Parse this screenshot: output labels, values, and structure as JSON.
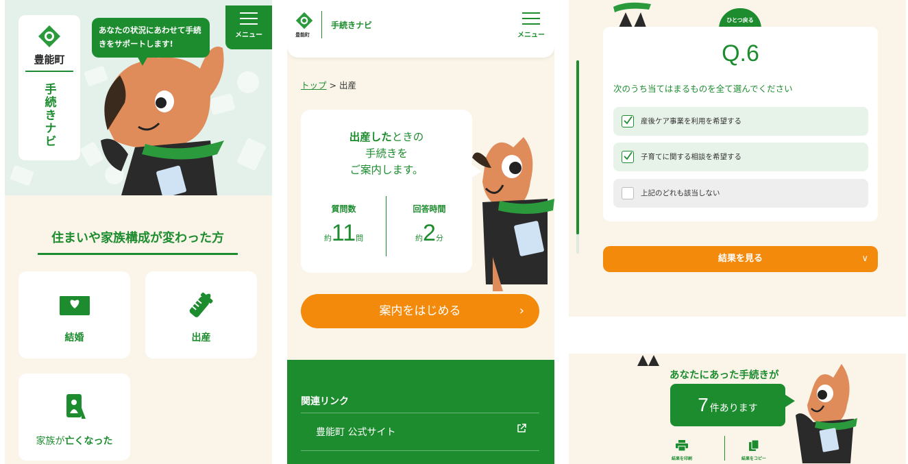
{
  "colors": {
    "green": "#1d8c2f",
    "orange": "#f48a0b",
    "cream": "#faf5e8",
    "mint": "#e4f0ea"
  },
  "panel1": {
    "logo": {
      "town": "豊能町",
      "app": "手続きナビ"
    },
    "speech": "あなたの状況にあわせて手続きをサポートします!",
    "menu_label": "メニュー",
    "section_title": "住まいや家族構成が変わった方",
    "categories": [
      {
        "icon": "letter-heart-icon",
        "label": "結婚"
      },
      {
        "icon": "baby-bottle-icon",
        "label": "出産"
      },
      {
        "icon": "portrait-frame-icon",
        "label_prefix": "家族が",
        "label_bold": "亡くなった"
      }
    ]
  },
  "panel2": {
    "header": {
      "town": "豊能町",
      "title": "手続きナビ",
      "menu_label": "メニュー"
    },
    "breadcrumb": {
      "top": "トップ",
      "sep": ">",
      "current": "出産"
    },
    "intro": {
      "bold": "出産した",
      "rest1": "ときの",
      "line2": "手続きを",
      "line3": "ご案内します。"
    },
    "stats": [
      {
        "label": "質問数",
        "prefix": "約",
        "value": "11",
        "unit": "問"
      },
      {
        "label": "回答時間",
        "prefix": "約",
        "value": "2",
        "unit": "分"
      }
    ],
    "start_button": "案内をはじめる",
    "footer": {
      "heading": "関連リンク",
      "link": "豊能町 公式サイト"
    }
  },
  "panel3": {
    "back_label": "ひとつ戻る",
    "question_number": "Q.6",
    "question_text": "次のうち当てはまるものを全て選んでください",
    "options": [
      {
        "label": "産後ケア事業を利用を希望する",
        "checked": true
      },
      {
        "label": "子育てに関する相談を希望する",
        "checked": true
      },
      {
        "label": "上記のどれも該当しない",
        "checked": false
      }
    ],
    "progress": 0.9,
    "result_button": "結果を見る",
    "result": {
      "heading": "あなたにあった手続きが",
      "count": "7",
      "suffix": "件あります",
      "print": "結果を印刷",
      "copy": "結果をコピー"
    }
  }
}
